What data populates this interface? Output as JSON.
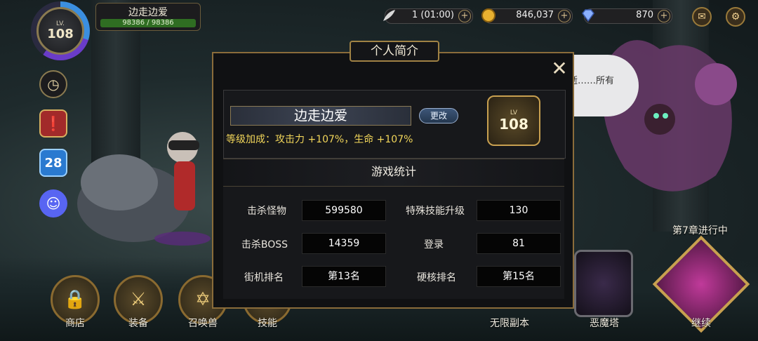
{
  "top_bar": {
    "level_prefix": "LV.",
    "level": "108",
    "player_name": "边走边爱",
    "hp_text": "98386 / 98386",
    "feather": {
      "value": "1 (01:00)",
      "plus": "+"
    },
    "gold": {
      "value": "846,037",
      "plus": "+"
    },
    "gems": {
      "value": "870",
      "plus": "+"
    },
    "icons": [
      "mail-icon",
      "settings-gear-icon"
    ]
  },
  "left_icons": [
    "clock-icon",
    "quest-book-icon",
    "calendar-icon",
    "discord-icon"
  ],
  "calendar_day": "28",
  "bottom_menu": [
    {
      "label": "商店"
    },
    {
      "label": "装备"
    },
    {
      "label": "召唤兽"
    },
    {
      "label": "技能"
    },
    {
      "label": "无限副本"
    },
    {
      "label": "恶魔塔"
    },
    {
      "label": "继续"
    }
  ],
  "speech_bubble": "这里的时间不会流逝……所有东西都保持着原样。",
  "chapter_status": "第7章进行中",
  "dialog": {
    "title": "个人简介",
    "close": "✕",
    "profile": {
      "name": "边走边爱",
      "edit_button": "更改",
      "bonus": "等级加成：攻击力 +107%，生命 +107%",
      "badge_level_prefix": "LV",
      "badge_level": "108"
    },
    "stats_title": "游戏统计",
    "stats": [
      {
        "label": "击杀怪物",
        "value": "599580"
      },
      {
        "label": "特殊技能升级",
        "value": "130"
      },
      {
        "label": "击杀BOSS",
        "value": "14359"
      },
      {
        "label": "登录",
        "value": "81"
      },
      {
        "label": "街机排名",
        "value": "第13名"
      },
      {
        "label": "硬核排名",
        "value": "第15名"
      }
    ]
  }
}
